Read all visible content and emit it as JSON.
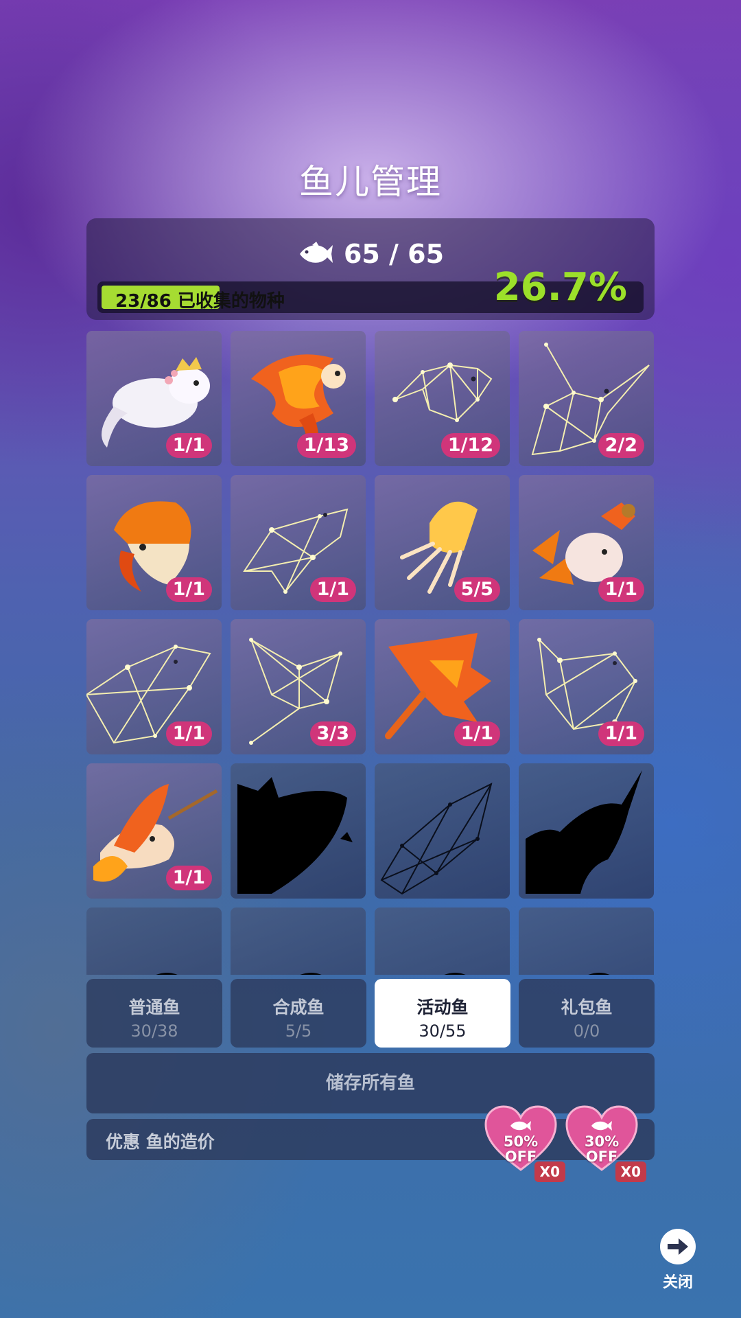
{
  "header": {
    "title": "鱼儿管理"
  },
  "stats": {
    "fish_icon": "fish-icon",
    "fish_count": "65 / 65",
    "collected_label": "23/86 已收集的物种",
    "collected_fraction": 0.267,
    "percent": "26.7%"
  },
  "grid": {
    "cells": [
      {
        "art": "axolotl-with-crown",
        "count": "1/1"
      },
      {
        "art": "orange-flame-fish",
        "count": "1/13"
      },
      {
        "art": "constellation-fish",
        "count": "1/12"
      },
      {
        "art": "constellation-swordfish",
        "count": "2/2"
      },
      {
        "art": "mushroom-fish",
        "count": "1/1"
      },
      {
        "art": "constellation-turtle",
        "count": "1/1"
      },
      {
        "art": "glowing-jellyfish",
        "count": "5/5"
      },
      {
        "art": "autumn-leaf-fish",
        "count": "1/1"
      },
      {
        "art": "constellation-dolphin",
        "count": "1/1"
      },
      {
        "art": "constellation-ray",
        "count": "3/3"
      },
      {
        "art": "maple-leaf-fish",
        "count": "1/1"
      },
      {
        "art": "constellation-pufferfish",
        "count": "1/1"
      },
      {
        "art": "orange-fairy-fish",
        "count": "1/1"
      },
      {
        "art": "locked-whale-silhouette",
        "count": ""
      },
      {
        "art": "locked-wireframe-whale",
        "count": ""
      },
      {
        "art": "locked-unicorn-silhouette",
        "count": ""
      },
      {
        "art": "locked-fish-silhouette",
        "count": ""
      },
      {
        "art": "locked-fish-silhouette",
        "count": ""
      },
      {
        "art": "locked-fish-silhouette",
        "count": ""
      },
      {
        "art": "locked-fish-silhouette",
        "count": ""
      }
    ]
  },
  "tabs": [
    {
      "label": "普通鱼",
      "count": "30/38"
    },
    {
      "label": "合成鱼",
      "count": "5/5"
    },
    {
      "label": "活动鱼",
      "count": "30/55"
    },
    {
      "label": "礼包鱼",
      "count": "0/0"
    }
  ],
  "store_button": "储存所有鱼",
  "discount": {
    "label": "优惠 鱼的造价",
    "coupons": [
      {
        "percent": "50%",
        "off": "OFF",
        "qty": "X0"
      },
      {
        "percent": "30%",
        "off": "OFF",
        "qty": "X0"
      }
    ]
  },
  "close": {
    "label": "关闭",
    "icon": "arrow-right-icon"
  },
  "colors": {
    "badge": "#d0357a",
    "progress": "#a6dc32",
    "percent": "#9ce02a",
    "coupon_heart": "#e0559a"
  }
}
